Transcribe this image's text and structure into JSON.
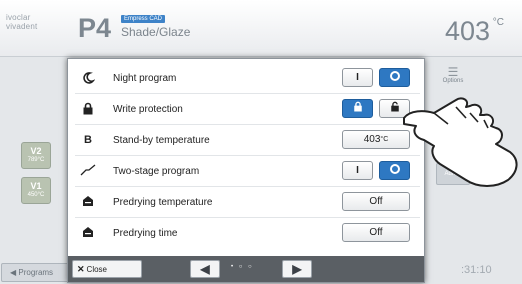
{
  "header": {
    "brand": "ivoclar vivadent",
    "model": "P4",
    "program_tag": "Empress CAD",
    "program_name": "Shade/Glaze",
    "temperature": "403",
    "temperature_unit": "°C"
  },
  "left_dock": {
    "buttons": [
      {
        "label": "V2",
        "temp": "789°C"
      },
      {
        "label": "V1",
        "temp": "450°C"
      }
    ],
    "programs_label": "Programs"
  },
  "right_dock": {
    "options_label": "Options",
    "admin_label": "Admin",
    "clock": ":31:10"
  },
  "dialog": {
    "rows": [
      {
        "icon": "moon-icon",
        "label": "Night program",
        "control": "toggle",
        "on_label": "I",
        "active": "off"
      },
      {
        "icon": "lock-icon",
        "label": "Write protection",
        "control": "toggle",
        "active": "on"
      },
      {
        "icon": "b-icon",
        "label": "Stand-by temperature",
        "control": "value",
        "value": "403",
        "unit": "°C"
      },
      {
        "icon": "two-stage-icon",
        "label": "Two-stage program",
        "control": "toggle",
        "on_label": "I",
        "active": "off"
      },
      {
        "icon": "predrying-icon",
        "label": "Predrying temperature",
        "control": "value",
        "value": "Off"
      },
      {
        "icon": "predrying-icon",
        "label": "Predrying time",
        "control": "value",
        "value": "Off"
      }
    ],
    "close_label": "Close",
    "page_dots": "• ○ ○"
  },
  "colors": {
    "accent": "#2e78c2",
    "dock_green": "#b9c3b1",
    "bar": "#5a5f64"
  }
}
